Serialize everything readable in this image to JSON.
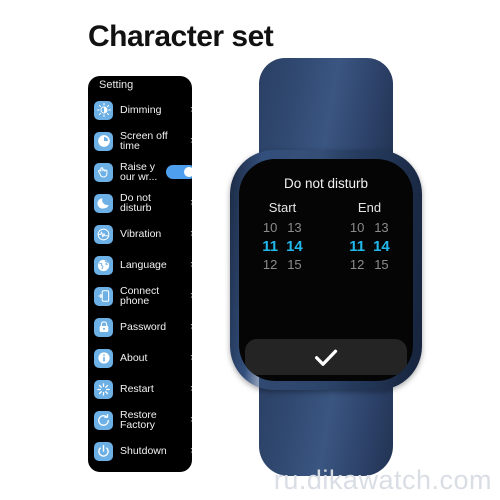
{
  "page": {
    "title": "Character set",
    "watermark": "ru.dikawatch.com"
  },
  "settings_panel": {
    "header": "Setting",
    "chevron_glyph": "›",
    "tile_color": "#6cb0e6",
    "panel_background": "#000000",
    "items": [
      {
        "label": "Dimming",
        "icon": "brightness-icon",
        "accessory": "chevron"
      },
      {
        "label": "Screen off\ntime",
        "icon": "clock-icon",
        "accessory": "chevron"
      },
      {
        "label": "Raise y\nour wr...",
        "icon": "raise-wrist-icon",
        "accessory": "toggle",
        "toggle_on": true
      },
      {
        "label": "Do not\ndisturb",
        "icon": "moon-icon",
        "accessory": "chevron"
      },
      {
        "label": "Vibration",
        "icon": "vibration-icon",
        "accessory": "chevron"
      },
      {
        "label": "Language",
        "icon": "globe-icon",
        "accessory": "chevron"
      },
      {
        "label": "Connect\nphone",
        "icon": "connect-phone-icon",
        "accessory": "chevron"
      },
      {
        "label": "Password",
        "icon": "lock-icon",
        "accessory": "chevron"
      },
      {
        "label": "About",
        "icon": "info-icon",
        "accessory": "chevron"
      },
      {
        "label": "Restart",
        "icon": "restart-icon",
        "accessory": "chevron"
      },
      {
        "label": "Restore\nFactory",
        "icon": "restore-factory-icon",
        "accessory": "chevron"
      },
      {
        "label": "Shutdown",
        "icon": "power-icon",
        "accessory": "chevron"
      }
    ]
  },
  "watch": {
    "band_color": "#31497093",
    "screen": {
      "title": "Do not disturb",
      "selected_color": "#22b8ec",
      "columns": [
        {
          "heading": "Start",
          "hours": {
            "above": "10",
            "selected": "11",
            "below": "12"
          },
          "minutes": {
            "above": "13",
            "selected": "14",
            "below": "15"
          }
        },
        {
          "heading": "End",
          "hours": {
            "above": "10",
            "selected": "11",
            "below": "12"
          },
          "minutes": {
            "above": "13",
            "selected": "14",
            "below": "15"
          }
        }
      ],
      "confirm_icon": "check-icon"
    }
  }
}
